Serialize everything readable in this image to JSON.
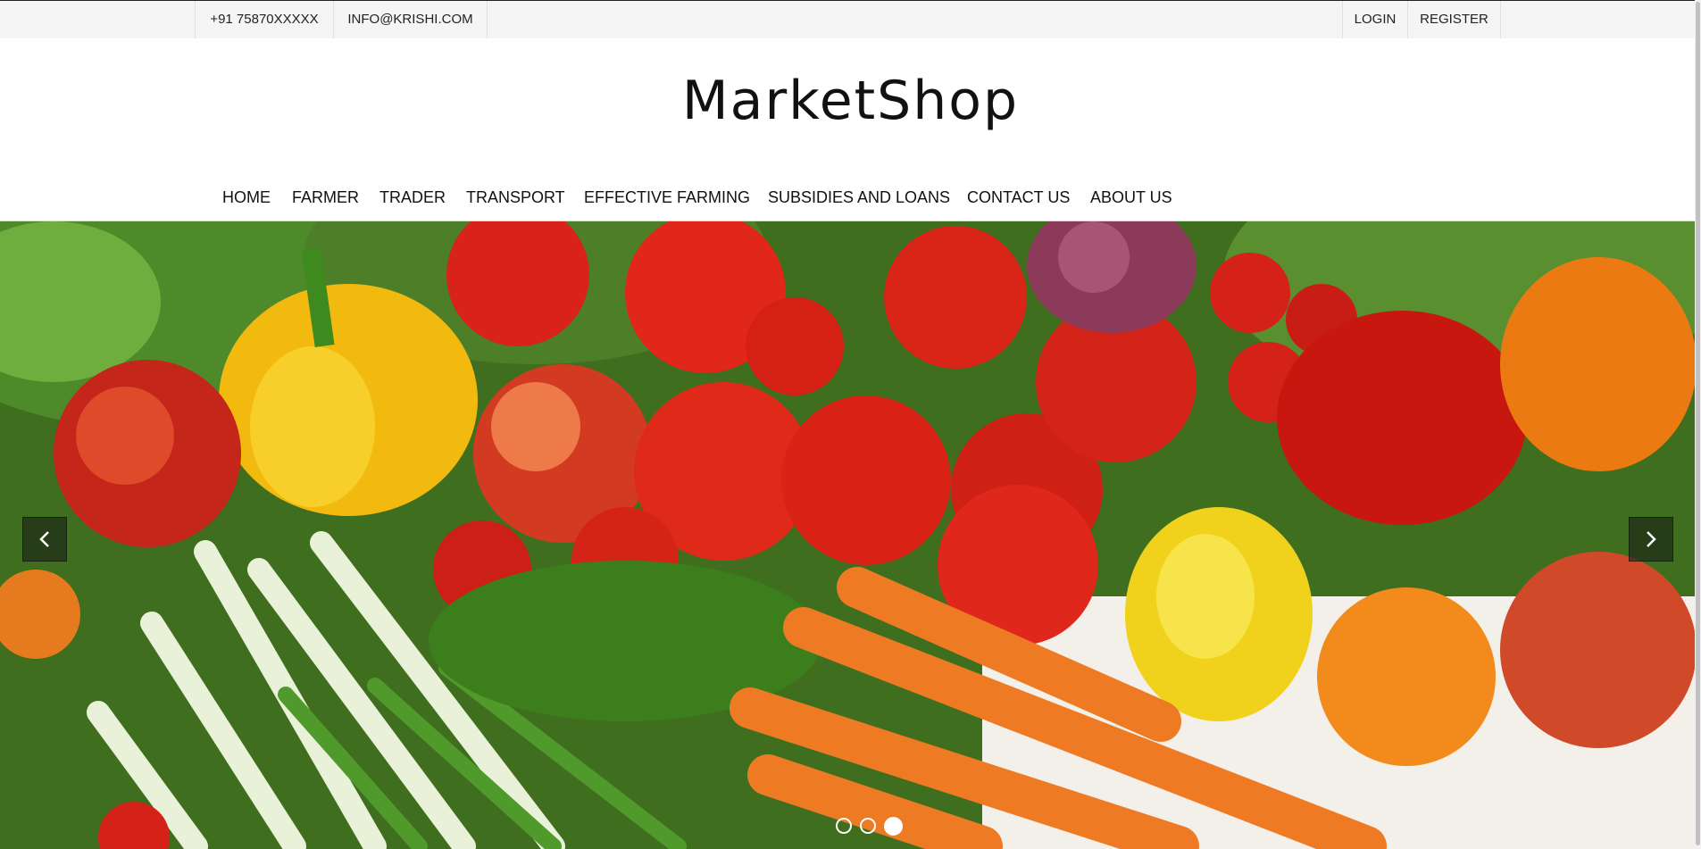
{
  "topbar": {
    "phone": "+91 75870XXXXX",
    "email": "INFO@KRISHI.COM",
    "login_label": "LOGIN",
    "register_label": "REGISTER"
  },
  "logo": {
    "text": "MarketShop"
  },
  "nav": {
    "items": [
      {
        "label": "HOME"
      },
      {
        "label": "FARMER"
      },
      {
        "label": "TRADER"
      },
      {
        "label": "TRANSPORT"
      },
      {
        "label": "EFFECTIVE FARMING"
      },
      {
        "label": "SUBSIDIES AND LOANS"
      },
      {
        "label": "CONTACT US"
      },
      {
        "label": "ABOUT US"
      }
    ]
  },
  "slider": {
    "image_alt": "Fresh vegetables and fruits",
    "slide_count": 3,
    "active_slide": 3,
    "prev_icon": "chevron-left-icon",
    "next_icon": "chevron-right-icon"
  }
}
